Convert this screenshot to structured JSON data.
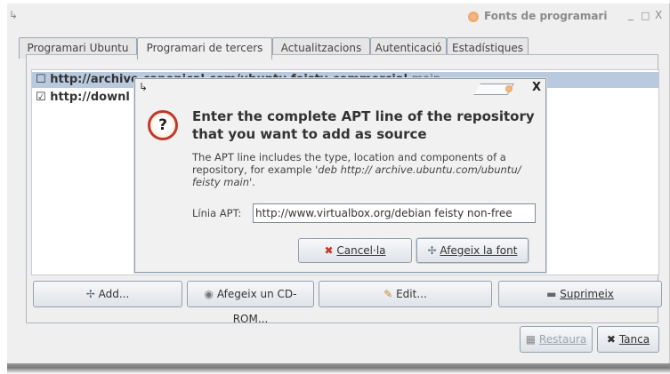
{
  "window": {
    "corner_glyph": "↳",
    "title": "Fonts de programari",
    "controls": [
      "_",
      "□",
      "X"
    ]
  },
  "tabs": [
    {
      "label": "Programari Ubuntu"
    },
    {
      "label": "Programari de tercers"
    },
    {
      "label": "Actualitzacions"
    },
    {
      "label": "Autenticació"
    },
    {
      "label": "Estadístiques"
    }
  ],
  "sources": [
    {
      "url": "http://archive.canonical.com/ubuntu feisty-commercial",
      "component": "main",
      "checked": false
    },
    {
      "url": "http://downl",
      "checked": true
    }
  ],
  "buttons": {
    "add": "Add...",
    "add_cdrom": "Afegeix un CD-ROM...",
    "edit": "Edit...",
    "remove": "Suprimeix",
    "revert": "Restaura",
    "close": "Tanca"
  },
  "dialog": {
    "corner_glyph": "↳",
    "close_glyph": "X",
    "heading": "Enter the complete APT line of the repository that you want to add as source",
    "description": "The APT line includes the type, location and components of a repository, for example ",
    "example": "'deb http:// archive.ubuntu.com/ubuntu/ feisty main'",
    "description_end": ".",
    "apt_label": "Línia APT:",
    "apt_value": "http://www.virtualbox.org/debian feisty non-free",
    "cancel": "Cancel·la",
    "add_source": "Afegeix la font"
  }
}
